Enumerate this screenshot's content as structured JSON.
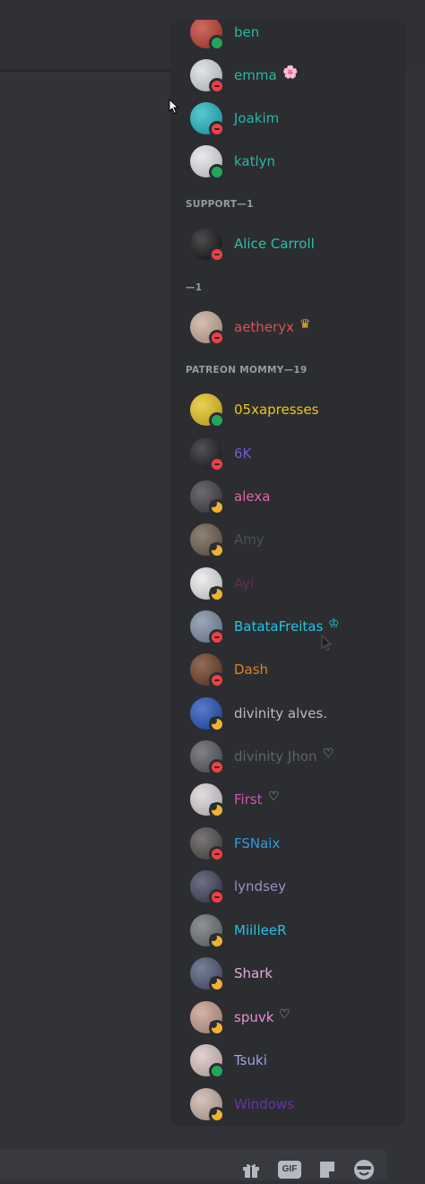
{
  "groups": [
    {
      "label": "SUPPORT—1"
    },
    {
      "label": "—1"
    },
    {
      "label": "PATREON MOMMY—19"
    }
  ],
  "members": [
    {
      "name": "ben",
      "color": "#29b6a4",
      "status": "online",
      "avatar": "#c0392b"
    },
    {
      "name": "emma",
      "color": "#29b6a4",
      "status": "dnd",
      "avatar": "#d7dbe0",
      "badge": "🌸"
    },
    {
      "name": "Joakim",
      "color": "#29b6a4",
      "status": "dnd",
      "avatar": "#1fb6c3"
    },
    {
      "name": "katlyn",
      "color": "#29b6a4",
      "status": "online",
      "avatar": "#e3e4e8"
    },
    {
      "name": "Alice Carroll",
      "color": "#2fbfa5",
      "status": "dnd",
      "avatar": "#111114"
    },
    {
      "name": "aetheryx",
      "color": "#d9534f",
      "status": "dnd",
      "avatar": "#c9a99a",
      "badge": "♛"
    },
    {
      "name": "05xapresses",
      "color": "#f1c40f",
      "status": "online",
      "avatar": "#e6c21a"
    },
    {
      "name": "6K",
      "color": "#6f5bd3",
      "status": "dnd",
      "avatar": "#16181c"
    },
    {
      "name": "alexa",
      "color": "#e066a3",
      "status": "idle",
      "avatar": "#3b3c44"
    },
    {
      "name": "Amy",
      "color": "#4e5058",
      "status": "idle",
      "avatar": "#6a5a4a"
    },
    {
      "name": "Ayi",
      "color": "#6b2a55",
      "status": "idle",
      "avatar": "#e8e8ea"
    },
    {
      "name": "BatataFreitas",
      "color": "#22c3e6",
      "status": "dnd",
      "avatar": "#7a8aa3",
      "badge": "♔"
    },
    {
      "name": "Dash",
      "color": "#e67e22",
      "status": "dnd",
      "avatar": "#6b3a1e"
    },
    {
      "name": "divinity alves.",
      "color": "#b9bbbe",
      "status": "idle",
      "avatar": "#1f4fb8"
    },
    {
      "name": "divinity Jhon",
      "color": "#5f6168",
      "status": "dnd",
      "avatar": "#55575c",
      "badge": "♡"
    },
    {
      "name": "First",
      "color": "#d64fb4",
      "status": "idle",
      "avatar": "#d9d2d6",
      "badge": "♡"
    },
    {
      "name": "FSNaix",
      "color": "#3498db",
      "status": "dnd",
      "avatar": "#4d4a48"
    },
    {
      "name": "lyndsey",
      "color": "#9b8fc7",
      "status": "dnd",
      "avatar": "#3c3f5a"
    },
    {
      "name": "MiilleeR",
      "color": "#22c3e6",
      "status": "idle",
      "avatar": "#6b6e72"
    },
    {
      "name": "Shark",
      "color": "#e8a7e0",
      "status": "idle",
      "avatar": "#4a5575"
    },
    {
      "name": "spuvk",
      "color": "#ea8ed8",
      "status": "idle",
      "avatar": "#c49a8a",
      "badge": "♡"
    },
    {
      "name": "Tsuki",
      "color": "#9aa7e0",
      "status": "online",
      "avatar": "#d8c2c0"
    },
    {
      "name": "Windows",
      "color": "#6a32a8",
      "status": "idle",
      "avatar": "#c8b0a6"
    }
  ],
  "toolbar": {
    "gift_icon": "gift-icon",
    "gif_label": "GIF",
    "sticker_icon": "sticker-icon",
    "emoji_icon": "emoji-icon"
  }
}
